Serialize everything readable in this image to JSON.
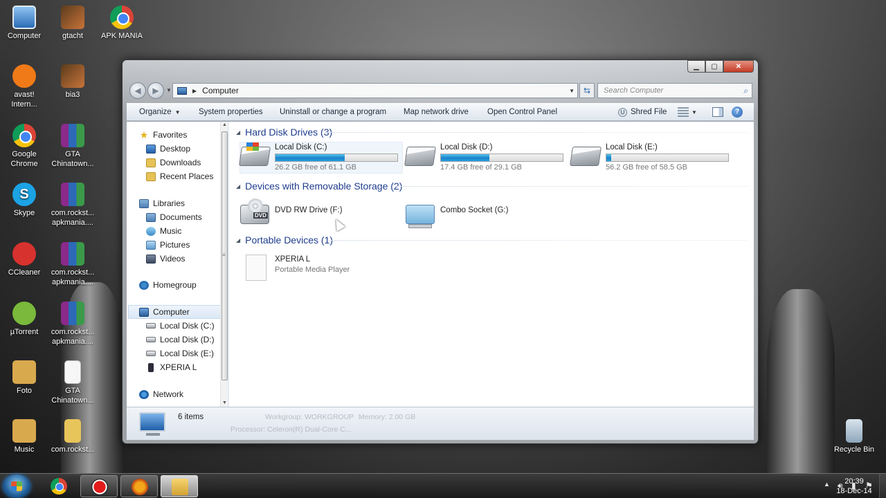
{
  "desktop": {
    "icons": [
      {
        "label": "Computer",
        "icon": "computer-icon"
      },
      {
        "label": "gtacht",
        "icon": "game-shortcut-icon"
      },
      {
        "label": "APK MANIA",
        "icon": "chrome-shortcut-icon"
      },
      {
        "label": "avast! Intern...",
        "icon": "avast-icon"
      },
      {
        "label": "bia3",
        "icon": "game-shortcut-icon"
      },
      {
        "label": "Google Chrome",
        "icon": "chrome-icon"
      },
      {
        "label": "GTA Chinatown...",
        "icon": "winrar-archive-icon"
      },
      {
        "label": "Skype",
        "icon": "skype-icon"
      },
      {
        "label": "com.rockst... apkmania....",
        "icon": "winrar-archive-icon"
      },
      {
        "label": "CCleaner",
        "icon": "ccleaner-icon"
      },
      {
        "label": "com.rockst... apkmania....",
        "icon": "winrar-archive-icon"
      },
      {
        "label": "µTorrent",
        "icon": "utorrent-icon"
      },
      {
        "label": "com.rockst... apkmania....",
        "icon": "winrar-archive-icon"
      },
      {
        "label": "Foto",
        "icon": "folder-icon"
      },
      {
        "label": "GTA Chinatown...",
        "icon": "file-icon"
      },
      {
        "label": "Music",
        "icon": "folder-icon"
      },
      {
        "label": "com.rockst...",
        "icon": "folder-icon"
      },
      {
        "label": "Recycle Bin",
        "icon": "recycle-bin-icon"
      }
    ]
  },
  "window": {
    "address": {
      "location": "Computer"
    },
    "search": {
      "placeholder": "Search Computer"
    },
    "toolbar": {
      "organize": "Organize",
      "system_properties": "System properties",
      "uninstall": "Uninstall or change a program",
      "map_network_drive": "Map network drive",
      "open_control_panel": "Open Control Panel",
      "shred_file": "Shred File"
    },
    "nav": {
      "favorites": {
        "label": "Favorites",
        "items": [
          "Desktop",
          "Downloads",
          "Recent Places"
        ]
      },
      "libraries": {
        "label": "Libraries",
        "items": [
          "Documents",
          "Music",
          "Pictures",
          "Videos"
        ]
      },
      "homegroup": "Homegroup",
      "computer": {
        "label": "Computer",
        "items": [
          "Local Disk (C:)",
          "Local Disk (D:)",
          "Local Disk (E:)",
          "XPERIA L"
        ]
      },
      "network": "Network"
    },
    "sections": {
      "hard_disk": {
        "title": "Hard Disk Drives (3)",
        "drives": [
          {
            "name": "Local Disk (C:)",
            "free_text": "26.2 GB free of 61.1 GB",
            "used_fraction": 0.57
          },
          {
            "name": "Local Disk (D:)",
            "free_text": "17.4 GB free of 29.1 GB",
            "used_fraction": 0.4
          },
          {
            "name": "Local Disk (E:)",
            "free_text": "56.2 GB free of 58.5 GB",
            "used_fraction": 0.04
          }
        ]
      },
      "removable": {
        "title": "Devices with Removable Storage (2)",
        "devices": [
          {
            "name": "DVD RW Drive (F:)",
            "badge": "DVD"
          },
          {
            "name": "Combo Socket (G:)"
          }
        ]
      },
      "portable": {
        "title": "Portable Devices (1)",
        "devices": [
          {
            "name": "XPERIA L",
            "subtitle": "Portable Media Player"
          }
        ]
      }
    },
    "details": {
      "item_count": "6 items",
      "ghost_workgroup": "Workgroup: WORKGROUP",
      "ghost_memory": "Memory: 2.00 GB",
      "ghost_processor": "Processor: Celeron(R) Dual-Core C..."
    }
  },
  "taskbar": {
    "clock": {
      "time": "20:39",
      "date": "18-Dec-14"
    },
    "buttons": [
      "chrome",
      "screen-recorder",
      "winamp",
      "windows-explorer"
    ]
  },
  "colors": {
    "section_title": "#1e3c8c",
    "usage_bar": "#26a2e2",
    "taskbar": "#1e1e1e"
  }
}
